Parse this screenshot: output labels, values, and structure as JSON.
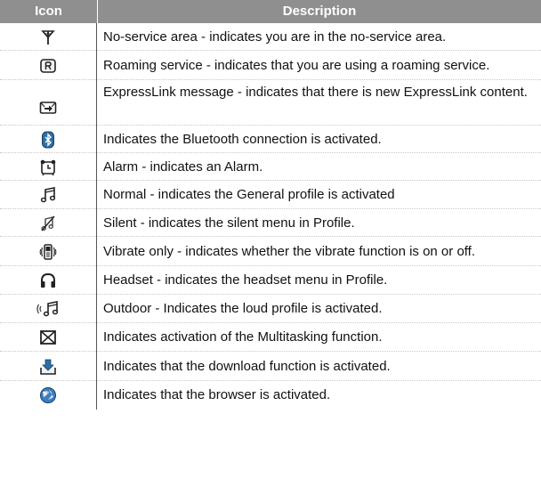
{
  "table": {
    "headers": {
      "icon": "Icon",
      "description": "Description"
    },
    "rows": [
      {
        "icon": "no-service-antenna-icon",
        "description": "No-service area - indicates you are in the no-service area."
      },
      {
        "icon": "roaming-r-icon",
        "description": "Roaming service - indicates that you are using a roaming service."
      },
      {
        "icon": "expresslink-message-icon",
        "description": "ExpressLink message - indicates that there is new ExpressLink content."
      },
      {
        "icon": "bluetooth-icon",
        "description": "Indicates the Bluetooth connection is activated."
      },
      {
        "icon": "alarm-clock-icon",
        "description": "Alarm - indicates an Alarm."
      },
      {
        "icon": "music-note-icon",
        "description": "Normal - indicates the General profile is activated"
      },
      {
        "icon": "silent-note-icon",
        "description": "Silent - indicates the silent menu in Profile."
      },
      {
        "icon": "vibrate-phone-icon",
        "description": "Vibrate only - indicates whether the vibrate function is on or off."
      },
      {
        "icon": "headset-icon",
        "description": "Headset - indicates the headset menu in Profile."
      },
      {
        "icon": "loud-note-icon",
        "description": "Outdoor - Indicates the loud profile is activated."
      },
      {
        "icon": "multitasking-envelope-icon",
        "description": "Indicates activation of the Multitasking function."
      },
      {
        "icon": "download-tray-icon",
        "description": "Indicates that the download function is activated."
      },
      {
        "icon": "browser-globe-icon",
        "description": "Indicates that the browser is activated."
      }
    ]
  }
}
